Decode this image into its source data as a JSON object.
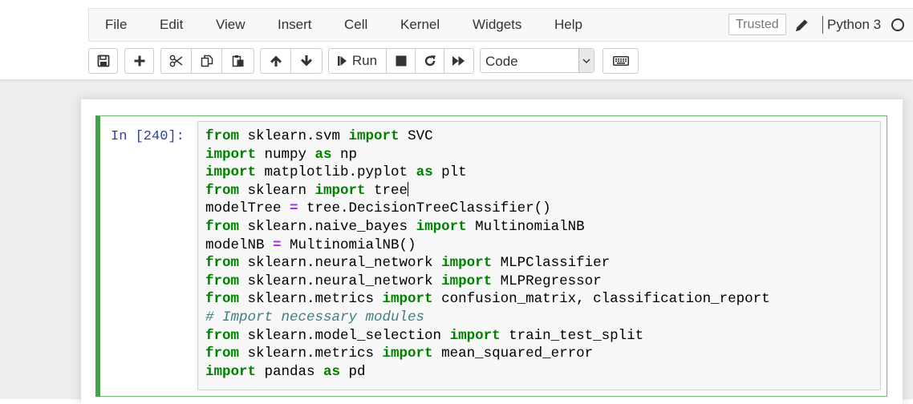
{
  "menu": {
    "items": [
      {
        "id": "file",
        "label": "File"
      },
      {
        "id": "edit",
        "label": "Edit"
      },
      {
        "id": "view",
        "label": "View"
      },
      {
        "id": "insert",
        "label": "Insert"
      },
      {
        "id": "cell",
        "label": "Cell"
      },
      {
        "id": "kernel",
        "label": "Kernel"
      },
      {
        "id": "widgets",
        "label": "Widgets"
      },
      {
        "id": "help",
        "label": "Help"
      }
    ],
    "trusted_label": "Trusted",
    "kernel_name": "Python 3"
  },
  "toolbar": {
    "run_label": "Run",
    "cell_type_value": "Code",
    "buttons": [
      {
        "id": "save",
        "icon": "save-icon"
      },
      {
        "id": "insert-cell-below",
        "icon": "plus-icon"
      },
      {
        "id": "cut",
        "icon": "scissors-icon"
      },
      {
        "id": "copy",
        "icon": "copy-icon"
      },
      {
        "id": "paste",
        "icon": "paste-icon"
      },
      {
        "id": "move-up",
        "icon": "arrow-up-icon"
      },
      {
        "id": "move-down",
        "icon": "arrow-down-icon"
      },
      {
        "id": "run",
        "icon": "step-forward-icon"
      },
      {
        "id": "interrupt",
        "icon": "stop-icon"
      },
      {
        "id": "restart",
        "icon": "restart-icon"
      },
      {
        "id": "restart-run-all",
        "icon": "fast-forward-icon"
      },
      {
        "id": "command-palette",
        "icon": "keyboard-icon"
      }
    ]
  },
  "colors": {
    "keyword": "#008000",
    "operator": "#aa22ff",
    "comment": "#408080",
    "prompt": "#303f9f",
    "cell_border_selected": "#43a047"
  },
  "cell": {
    "prompt": "In [240]:",
    "code_lines": [
      [
        {
          "t": "from",
          "c": "kw"
        },
        {
          "t": " sklearn.svm "
        },
        {
          "t": "import",
          "c": "kw"
        },
        {
          "t": " SVC"
        }
      ],
      [
        {
          "t": "import",
          "c": "kw"
        },
        {
          "t": " numpy "
        },
        {
          "t": "as",
          "c": "kw"
        },
        {
          "t": " np"
        }
      ],
      [
        {
          "t": "import",
          "c": "kw"
        },
        {
          "t": " matplotlib.pyplot "
        },
        {
          "t": "as",
          "c": "kw"
        },
        {
          "t": " plt"
        }
      ],
      [
        {
          "t": "from",
          "c": "kw"
        },
        {
          "t": " sklearn "
        },
        {
          "t": "import",
          "c": "kw"
        },
        {
          "t": " tree"
        },
        {
          "caret": true
        }
      ],
      [
        {
          "t": "modelTree "
        },
        {
          "t": "=",
          "c": "op"
        },
        {
          "t": " tree.DecisionTreeClassifier()"
        }
      ],
      [
        {
          "t": "from",
          "c": "kw"
        },
        {
          "t": " sklearn.naive_bayes "
        },
        {
          "t": "import",
          "c": "kw"
        },
        {
          "t": " MultinomialNB"
        }
      ],
      [
        {
          "t": "modelNB "
        },
        {
          "t": "=",
          "c": "op"
        },
        {
          "t": " MultinomialNB()"
        }
      ],
      [
        {
          "t": "from",
          "c": "kw"
        },
        {
          "t": " sklearn.neural_network "
        },
        {
          "t": "import",
          "c": "kw"
        },
        {
          "t": " MLPClassifier"
        }
      ],
      [
        {
          "t": "from",
          "c": "kw"
        },
        {
          "t": " sklearn.neural_network "
        },
        {
          "t": "import",
          "c": "kw"
        },
        {
          "t": " MLPRegressor"
        }
      ],
      [
        {
          "t": "from",
          "c": "kw"
        },
        {
          "t": " sklearn.metrics "
        },
        {
          "t": "import",
          "c": "kw"
        },
        {
          "t": " confusion_matrix, classification_report"
        }
      ],
      [
        {
          "t": "# Import necessary modules",
          "c": "cm"
        }
      ],
      [
        {
          "t": "from",
          "c": "kw"
        },
        {
          "t": " sklearn.model_selection "
        },
        {
          "t": "import",
          "c": "kw"
        },
        {
          "t": " train_test_split"
        }
      ],
      [
        {
          "t": "from",
          "c": "kw"
        },
        {
          "t": " sklearn.metrics "
        },
        {
          "t": "import",
          "c": "kw"
        },
        {
          "t": " mean_squared_error"
        }
      ],
      [
        {
          "t": "import",
          "c": "kw"
        },
        {
          "t": " pandas "
        },
        {
          "t": "as",
          "c": "kw"
        },
        {
          "t": " pd"
        }
      ]
    ]
  }
}
